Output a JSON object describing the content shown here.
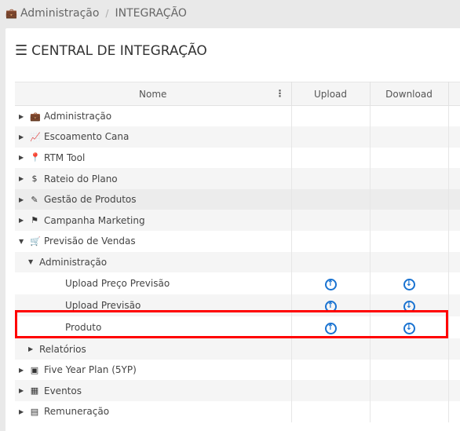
{
  "breadcrumb": {
    "parent": "Administração",
    "current": "INTEGRAÇÃO",
    "icon": "briefcase-icon"
  },
  "page_title": "CENTRAL DE INTEGRAÇÃO",
  "columns": [
    "Nome",
    "Upload",
    "Download"
  ],
  "rows": [
    {
      "label": "Administração",
      "icon": "briefcase-icon",
      "glyph": "💼",
      "level": 0,
      "expanded": false
    },
    {
      "label": "Escoamento Cana",
      "icon": "line-chart-icon",
      "glyph": "📈",
      "level": 0,
      "expanded": false
    },
    {
      "label": "RTM Tool",
      "icon": "map-marker-icon",
      "glyph": "📍",
      "level": 0,
      "expanded": false
    },
    {
      "label": "Rateio do Plano",
      "icon": "dollar-icon",
      "glyph": "$",
      "level": 0,
      "expanded": false
    },
    {
      "label": "Gestão de Produtos",
      "icon": "edit-icon",
      "glyph": "✎",
      "level": 0,
      "expanded": false
    },
    {
      "label": "Campanha Marketing",
      "icon": "flag-icon",
      "glyph": "⚑",
      "level": 0,
      "expanded": false
    },
    {
      "label": "Previsão de Vendas",
      "icon": "cart-icon",
      "glyph": "🛒",
      "level": 0,
      "expanded": true
    },
    {
      "label": "Administração",
      "level": 1,
      "expanded": true
    },
    {
      "label": "Upload Preço Previsão",
      "level": 2,
      "upload": true,
      "download": true
    },
    {
      "label": "Upload Previsão",
      "level": 2,
      "upload": true,
      "download": true
    },
    {
      "label": "Produto",
      "level": 2,
      "upload": true,
      "download": true,
      "highlighted": true
    },
    {
      "label": "Relatórios",
      "level": 1,
      "expanded": false
    },
    {
      "label": "Five Year Plan (5YP)",
      "icon": "money-icon",
      "glyph": "▣",
      "level": 0,
      "expanded": false
    },
    {
      "label": "Eventos",
      "icon": "calendar-icon",
      "glyph": "▦",
      "level": 0,
      "expanded": false
    },
    {
      "label": "Remuneração",
      "icon": "calculator-icon",
      "glyph": "▤",
      "level": 0,
      "expanded": false
    }
  ],
  "colors": {
    "accent": "#1a73d1",
    "highlight": "#ff0000"
  }
}
